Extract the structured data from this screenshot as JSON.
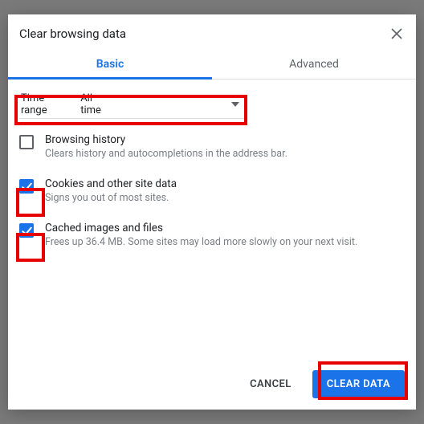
{
  "dialog": {
    "title": "Clear browsing data",
    "tabs": {
      "basic": "Basic",
      "advanced": "Advanced"
    },
    "timerange": {
      "label": "Time range",
      "value": "All time"
    },
    "options": {
      "history": {
        "title": "Browsing history",
        "desc": "Clears history and autocompletions in the address bar."
      },
      "cookies": {
        "title": "Cookies and other site data",
        "desc": "Signs you out of most sites."
      },
      "cache": {
        "title": "Cached images and files",
        "desc": "Frees up 36.4 MB. Some sites may load more slowly on your next visit."
      }
    },
    "buttons": {
      "cancel": "CANCEL",
      "confirm": "CLEAR DATA"
    }
  }
}
